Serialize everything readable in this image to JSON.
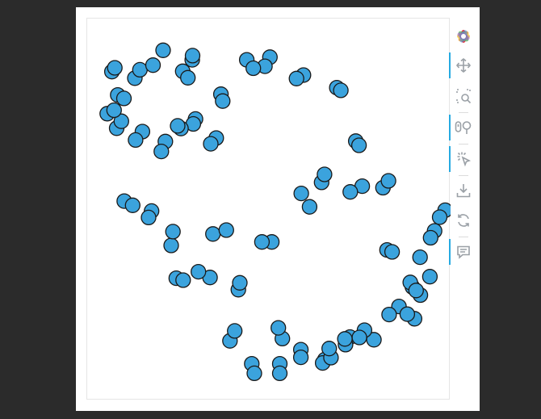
{
  "chart_data": {
    "type": "scatter",
    "title": "",
    "xlabel": "",
    "ylabel": "",
    "xlim": [
      0,
      100
    ],
    "ylim": [
      0,
      100
    ],
    "grid": false,
    "marker": {
      "fill": "#3ba3dd",
      "stroke": "#1a1a1a"
    },
    "x": [
      45.3,
      46.0,
      53.0,
      53.0,
      58.8,
      58.8,
      65.4,
      64.8,
      72.3,
      71.1,
      78.9,
      76.3,
      85.8,
      83.1,
      90.1,
      88.1,
      91.7,
      89.5,
      94.3,
      91.6,
      95.6,
      94.5,
      98.5,
      97.0,
      82.5,
      83.9,
      88.9,
      90.5,
      81.4,
      82.9,
      73.9,
      74.8,
      68.7,
      69.8,
      59.5,
      57.6,
      50.3,
      48.9,
      43.9,
      45.7,
      36.8,
      37.3,
      29.8,
      29.2,
      25.8,
      24.9,
      21.5,
      20.4,
      15.2,
      13.3,
      8.1,
      9.4,
      5.5,
      7.4,
      8.4,
      10.1,
      6.8,
      7.6,
      13.1,
      14.5,
      18.1,
      20.9,
      26.3,
      27.7,
      28.9,
      29.0,
      35.5,
      34.0,
      34.6,
      38.3,
      24.5,
      26.4,
      39.3,
      40.6,
      53.7,
      52.6,
      67.1,
      66.6,
      74.9,
      70.9,
      75.7,
      72.4,
      64.5,
      65.3,
      58.9,
      61.2,
      50.8,
      48.1,
      41.6,
      42.0,
      33.8,
      30.6,
      23.1,
      23.6,
      17.7,
      16.9,
      10.2,
      12.5
    ],
    "y": [
      9.6,
      7.1,
      9.6,
      7.1,
      13.3,
      11.3,
      10.7,
      9.8,
      16.6,
      14.6,
      15.9,
      18.4,
      24.6,
      22.5,
      21.4,
      22.6,
      27.6,
      29.7,
      32.4,
      37.5,
      44.4,
      42.6,
      49.8,
      48.0,
      39.4,
      38.9,
      30.9,
      28.8,
      55.7,
      57.5,
      67.9,
      66.8,
      81.9,
      81.2,
      85.2,
      84.3,
      89.9,
      87.5,
      89.2,
      87.0,
      80.2,
      78.4,
      73.7,
      72.4,
      71.2,
      71.9,
      67.8,
      65.2,
      70.4,
      68.2,
      71.3,
      73.1,
      75.1,
      76.0,
      80.0,
      79.1,
      86.1,
      87.1,
      84.4,
      86.6,
      87.8,
      91.7,
      86.2,
      84.5,
      89.2,
      90.3,
      68.7,
      67.2,
      43.6,
      44.6,
      32.0,
      31.5,
      15.6,
      18.2,
      16.2,
      19.0,
      11.2,
      13.6,
      16.5,
      16.1,
      56.1,
      54.6,
      57.1,
      59.2,
      54.2,
      50.7,
      41.5,
      41.5,
      29.0,
      30.8,
      32.2,
      33.7,
      40.6,
      44.2,
      49.6,
      47.9,
      52.2,
      51.1
    ]
  },
  "toolbar": {
    "logo_icon": "bokeh-logo",
    "tools": [
      {
        "name": "pan",
        "icon": "move-arrows-icon",
        "active": true
      },
      {
        "name": "box_zoom",
        "icon": "box-zoom-icon",
        "active": false
      },
      {
        "name": "wheel_zoom",
        "icon": "wheel-zoom-icon",
        "active": true
      },
      {
        "name": "tap",
        "icon": "tap-icon",
        "active": true
      },
      {
        "name": "save",
        "icon": "save-icon",
        "active": false
      },
      {
        "name": "reset",
        "icon": "reset-icon",
        "active": false
      },
      {
        "name": "hover",
        "icon": "hover-tooltip-icon",
        "active": true
      }
    ]
  }
}
